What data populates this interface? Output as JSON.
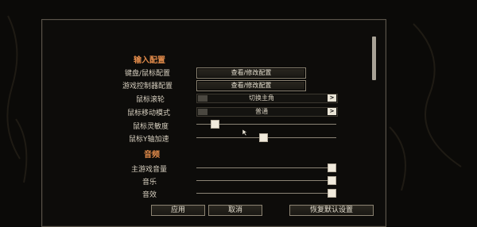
{
  "sections": {
    "input": "输入配置",
    "audio": "音频"
  },
  "rows": {
    "keyboard_mouse": {
      "label": "键盘/鼠标配置",
      "button": "查看/修改配置"
    },
    "controller": {
      "label": "游戏控制器配置",
      "button": "查看/修改配置"
    },
    "wheel": {
      "label": "鼠标滚轮",
      "value": "切换主角",
      "arrow": ">"
    },
    "move_mode": {
      "label": "鼠标移动模式",
      "value": "普通",
      "arrow": ">"
    },
    "sensitivity": {
      "label": "鼠标灵敏度",
      "level": 0.11
    },
    "y_accel": {
      "label": "鼠标Y轴加速",
      "level": 0.48
    },
    "master_volume": {
      "label": "主游戏音量",
      "level": 1.0
    },
    "music": {
      "label": "音乐",
      "level": 1.0
    },
    "sfx": {
      "label": "音效",
      "level": 1.0
    }
  },
  "footer": {
    "apply": "应用",
    "cancel": "取消",
    "restore": "恢复默认设置"
  },
  "colors": {
    "section_title": "#e08a4a",
    "background": "#0b0a08"
  }
}
